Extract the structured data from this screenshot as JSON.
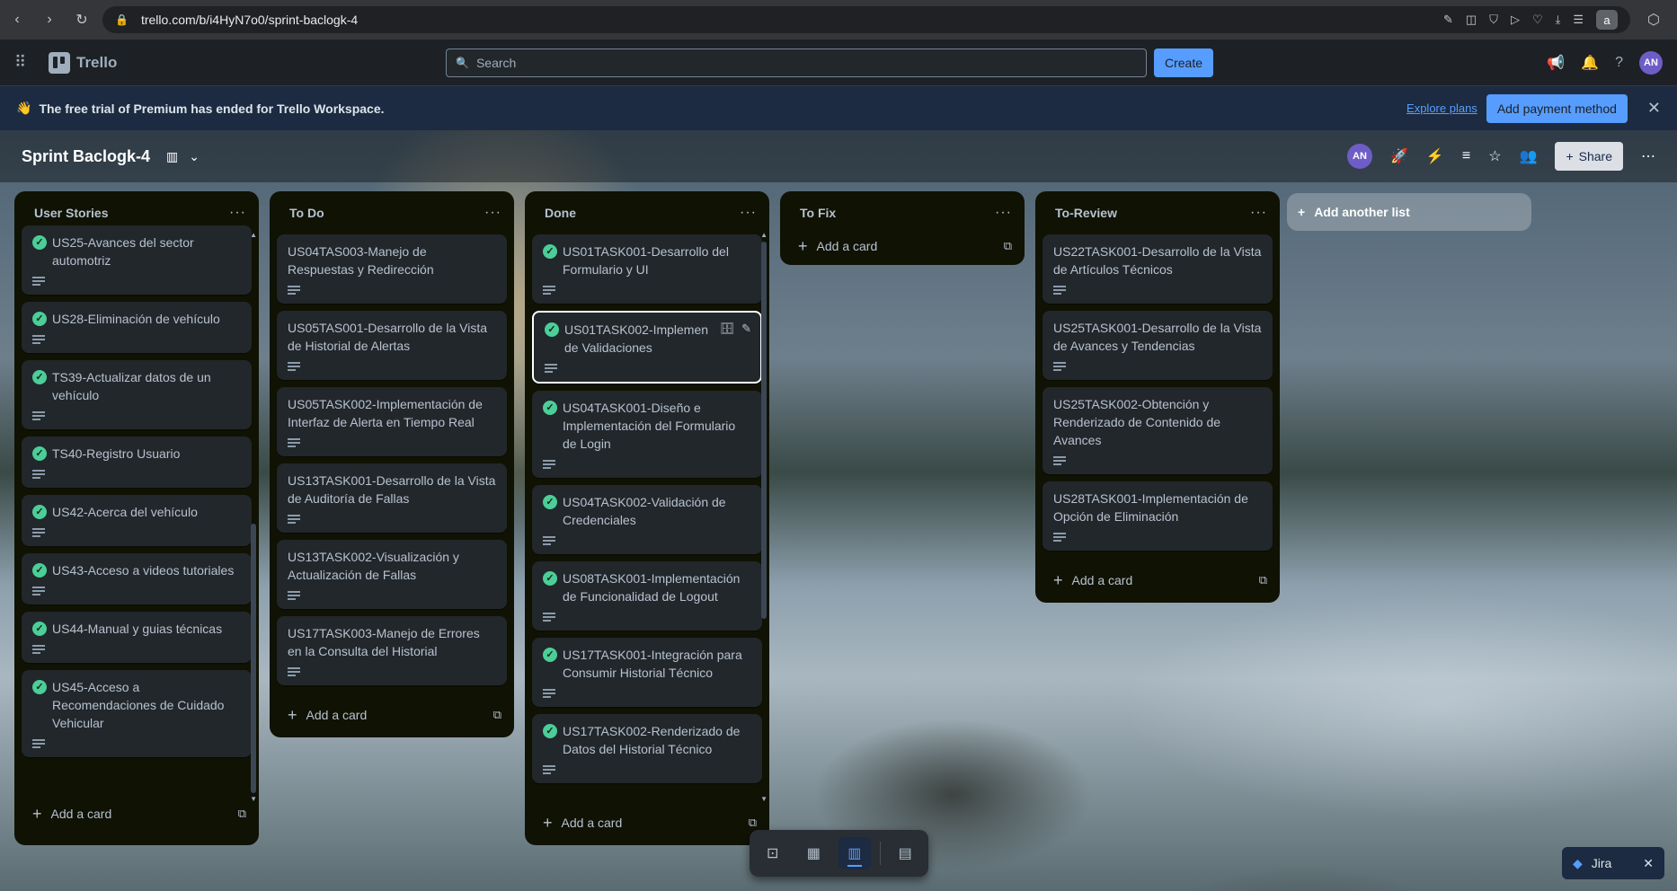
{
  "browser": {
    "url": "trello.com/b/i4HyN7o0/sprint-baclogk-4",
    "profile_initial": "a"
  },
  "header": {
    "app_name": "Trello",
    "search_placeholder": "Search",
    "create_label": "Create",
    "avatar_initials": "AN"
  },
  "banner": {
    "emoji": "👋",
    "message": "The free trial of Premium has ended for Trello Workspace.",
    "explore_label": "Explore plans",
    "pay_label": "Add payment method"
  },
  "board": {
    "title": "Sprint Baclogk-4",
    "member_initials": "AN",
    "share_label": "Share",
    "add_list_label": "Add another list"
  },
  "lists": [
    {
      "title": "User Stories",
      "add_label": "Add a card",
      "cards": [
        {
          "title": "US25-Avances del sector automotriz",
          "done": true
        },
        {
          "title": "US28-Eliminación de vehículo",
          "done": true
        },
        {
          "title": "TS39-Actualizar datos de un vehículo",
          "done": true
        },
        {
          "title": "TS40-Registro Usuario",
          "done": true
        },
        {
          "title": "US42-Acerca del vehículo",
          "done": true
        },
        {
          "title": "US43-Acceso a videos tutoriales",
          "done": true
        },
        {
          "title": "US44-Manual y guias técnicas",
          "done": true
        },
        {
          "title": "US45-Acceso a Recomendaciones de Cuidado Vehicular",
          "done": true
        }
      ]
    },
    {
      "title": "To Do",
      "add_label": "Add a card",
      "cards": [
        {
          "title": "US04TAS003-Manejo de Respuestas y Redirección",
          "done": false
        },
        {
          "title": "US05TAS001-Desarrollo de la Vista de Historial de Alertas",
          "done": false
        },
        {
          "title": "US05TASK002-Implementación de Interfaz de Alerta en Tiempo Real",
          "done": false
        },
        {
          "title": "US13TASK001-Desarrollo de la Vista de Auditoría de Fallas",
          "done": false
        },
        {
          "title": "US13TASK002-Visualización y Actualización de Fallas",
          "done": false
        },
        {
          "title": "US17TASK003-Manejo de Errores en la Consulta del Historial",
          "done": false
        }
      ]
    },
    {
      "title": "Done",
      "add_label": "Add a card",
      "cards": [
        {
          "title": "US01TASK001-Desarrollo del Formulario y UI",
          "done": true
        },
        {
          "title": "US01TASK002-Implementación de Validaciones",
          "title_display": "US01TASK002-Implemen",
          "title_display_2": "de Validaciones",
          "done": true,
          "active": true
        },
        {
          "title": "US04TASK001-Diseño e Implementación del Formulario de Login",
          "done": true
        },
        {
          "title": "US04TASK002-Validación de Credenciales",
          "done": true
        },
        {
          "title": "US08TASK001-Implementación de Funcionalidad de Logout",
          "done": true
        },
        {
          "title": "US17TASK001-Integración para Consumir Historial Técnico",
          "done": true
        },
        {
          "title": "US17TASK002-Renderizado de Datos del Historial Técnico",
          "done": true
        }
      ]
    },
    {
      "title": "To Fix",
      "add_label": "Add a card",
      "cards": []
    },
    {
      "title": "To-Review",
      "add_label": "Add a card",
      "cards": [
        {
          "title": "US22TASK001-Desarrollo de la Vista de Artículos Técnicos",
          "done": false
        },
        {
          "title": "US25TASK001-Desarrollo de la Vista de Avances y Tendencias",
          "done": false
        },
        {
          "title": "US25TASK002-Obtención y Renderizado de Contenido de Avances",
          "done": false
        },
        {
          "title": "US28TASK001-Implementación de Opción de Eliminación",
          "done": false
        }
      ]
    }
  ],
  "jira": {
    "label": "Jira"
  }
}
